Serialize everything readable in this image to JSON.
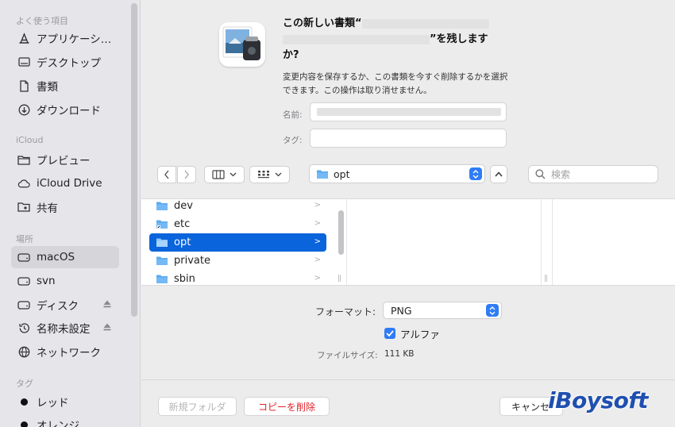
{
  "sidebar": {
    "favorites_header": "よく使う項目",
    "favorites": [
      {
        "label": "アプリケーシ…",
        "icon": "applications-icon"
      },
      {
        "label": "デスクトップ",
        "icon": "desktop-icon"
      },
      {
        "label": "書類",
        "icon": "document-icon"
      },
      {
        "label": "ダウンロード",
        "icon": "download-icon"
      }
    ],
    "icloud_header": "iCloud",
    "icloud": [
      {
        "label": "プレビュー",
        "icon": "folder-icon"
      },
      {
        "label": "iCloud Drive",
        "icon": "cloud-icon"
      },
      {
        "label": "共有",
        "icon": "shared-folder-icon"
      }
    ],
    "locations_header": "場所",
    "locations": [
      {
        "label": "macOS",
        "icon": "disk-icon",
        "selected": true
      },
      {
        "label": "svn",
        "icon": "disk-icon"
      },
      {
        "label": "ディスク",
        "icon": "disk-icon",
        "eject": true
      },
      {
        "label": "名称未設定",
        "icon": "history-icon",
        "eject": true
      },
      {
        "label": "ネットワーク",
        "icon": "network-icon"
      }
    ],
    "tags_header": "タグ",
    "tags": [
      {
        "label": "レッド",
        "color": "#111111"
      },
      {
        "label": "オレンジ",
        "color": "#111111"
      }
    ]
  },
  "dialog": {
    "title_line1": "この新しい書類“",
    "title_line2": "”を残します",
    "title_line3": "か?",
    "description": "変更内容を保存するか、この書類を今すぐ削除するかを選択できます。この操作は取り消せません。",
    "name_label": "名前:",
    "tag_label": "タグ:"
  },
  "toolbar": {
    "current_folder": "opt",
    "search_placeholder": "検索"
  },
  "browser": {
    "items": [
      {
        "name": "dev",
        "type": "folder"
      },
      {
        "name": "etc",
        "type": "alias"
      },
      {
        "name": "opt",
        "type": "folder",
        "selected": true
      },
      {
        "name": "private",
        "type": "folder"
      },
      {
        "name": "sbin",
        "type": "folder"
      }
    ]
  },
  "format": {
    "format_label": "フォーマット:",
    "format_value": "PNG",
    "alpha_label": "アルファ",
    "alpha_checked": true,
    "filesize_label": "ファイルサイズ:",
    "filesize_value": "111 KB"
  },
  "buttons": {
    "new_folder": "新規フォルダ",
    "delete_copy": "コピーを削除",
    "cancel": "キャンセ"
  },
  "watermark": "iBoysoft",
  "colors": {
    "accent": "#0a64dc",
    "danger": "#e0242a"
  }
}
